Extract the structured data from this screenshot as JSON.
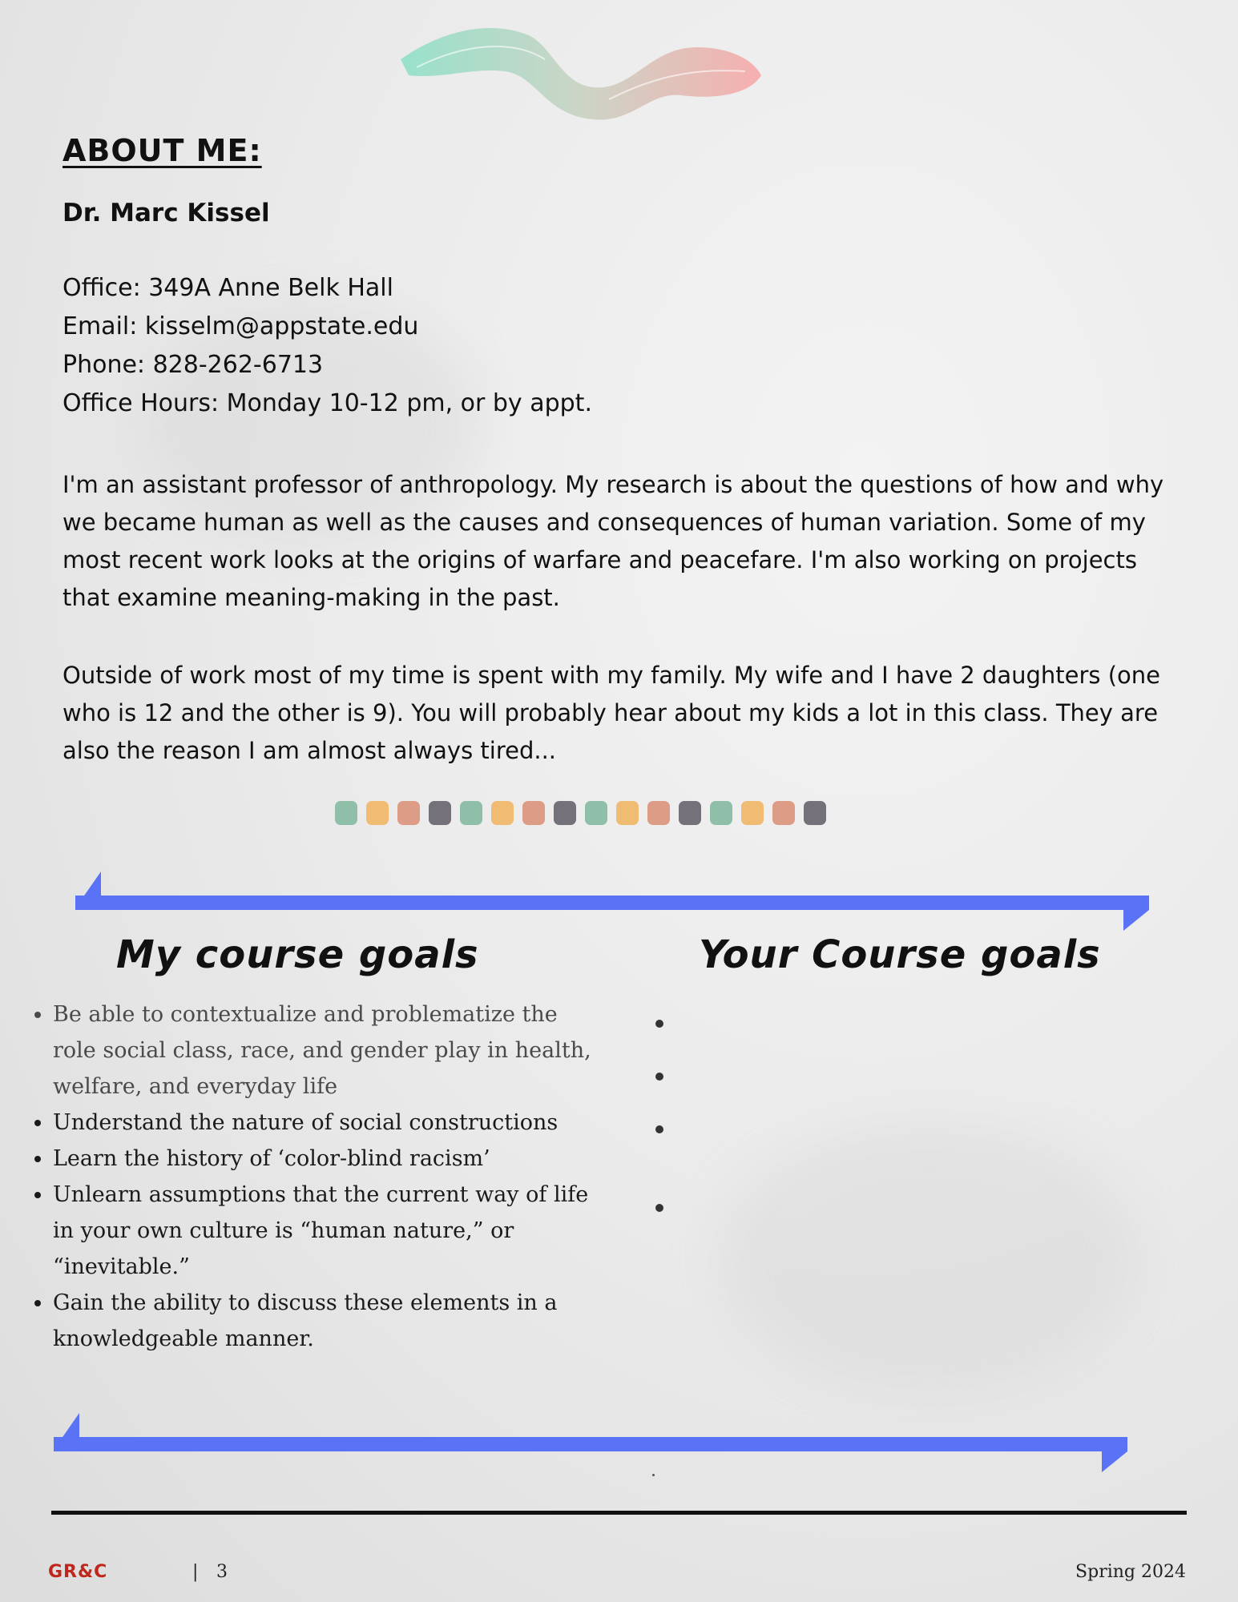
{
  "about": {
    "heading": "ABOUT ME:",
    "name": "Dr. Marc Kissel",
    "contact": {
      "office": "Office: 349A Anne Belk Hall",
      "email": "Email: kisselm@appstate.edu",
      "phone": "Phone: 828-262-6713",
      "hours": "Office Hours: Monday 10-12 pm, or by appt."
    },
    "paragraphs": [
      "I'm an assistant professor of anthropology. My research is about the questions of how and why we became human as well as the causes and consequences of human variation. Some of my most recent work looks at the origins of warfare and peacefare. I'm also working on projects that examine meaning-making in the past.",
      "Outside of work most of my time is spent with my family. My wife and I have 2 daughters (one who is 12 and the other is 9). You will probably hear about my kids a lot in this class. They are also the reason I am almost always tired..."
    ]
  },
  "swatch_colors": [
    "#8fbfa8",
    "#f0bb72",
    "#dd9c86",
    "#75717a",
    "#8fbfa8",
    "#f0bb72",
    "#dd9c86",
    "#75717a",
    "#8fbfa8",
    "#f0bb72",
    "#dd9c86",
    "#75717a",
    "#8fbfa8",
    "#f0bb72",
    "#dd9c86",
    "#75717a"
  ],
  "accent_color": "#5a72f6",
  "goals": {
    "my_heading": "My course goals",
    "your_heading": "Your Course goals",
    "my_items": [
      "Be able to contextualize and problematize the role social class, race, and gender play in health, welfare, and everyday life",
      "Understand the nature of social constructions",
      "Learn the history of ‘color-blind racism’",
      "Unlearn assumptions that the current way of life in your own culture is “human nature,” or “inevitable.”",
      "Gain the ability to discuss these elements in a knowledgeable  manner."
    ]
  },
  "footer": {
    "brand": "GR&C",
    "separator": "|",
    "page_number": "3",
    "term": "Spring 2024"
  }
}
